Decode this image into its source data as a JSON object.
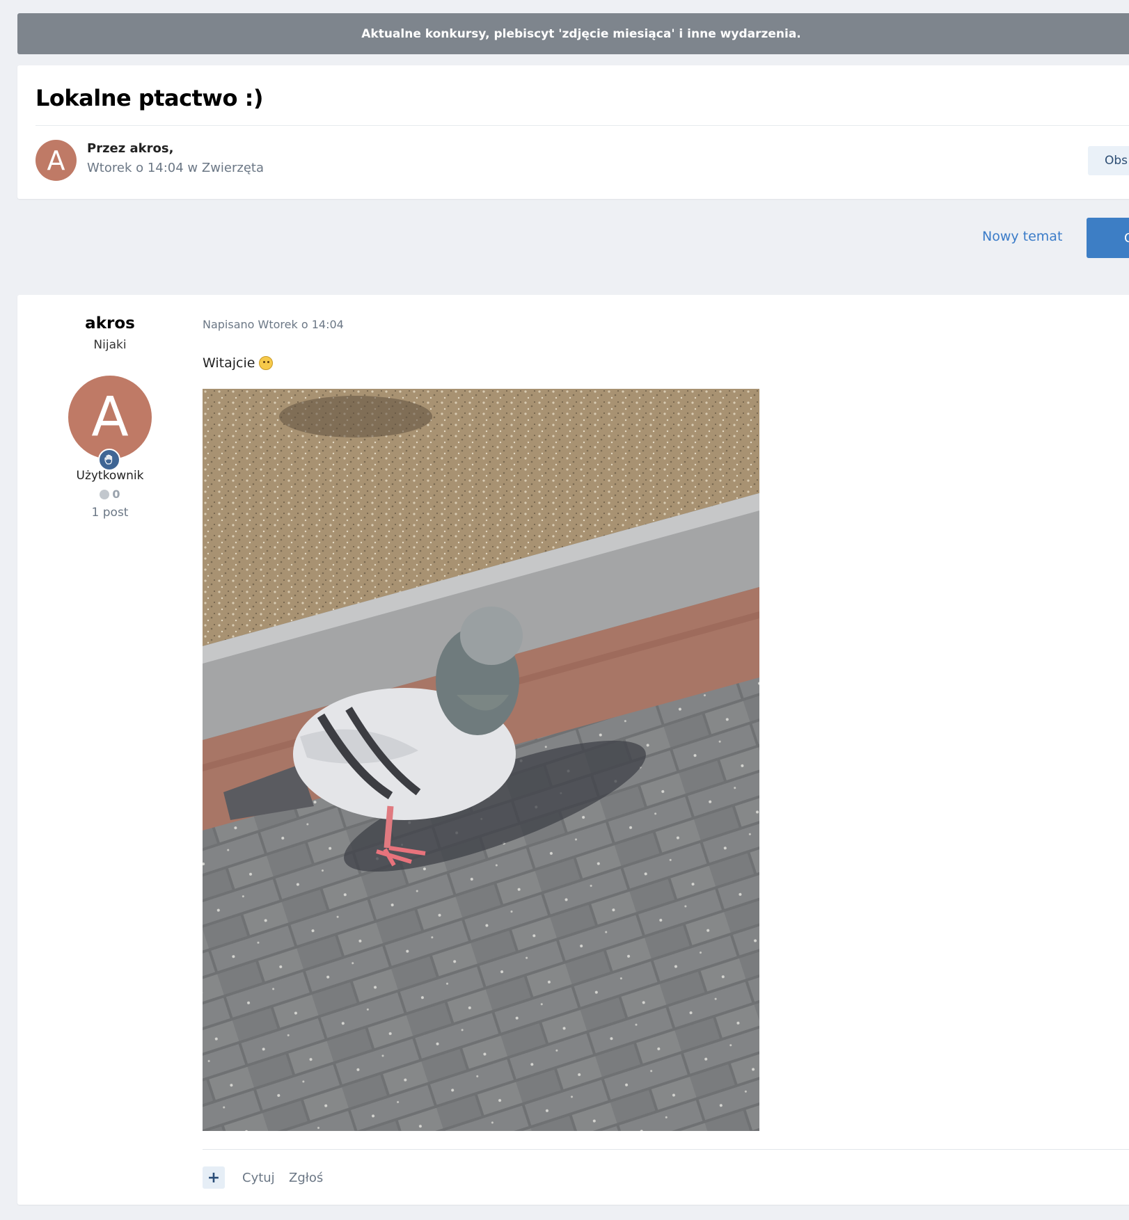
{
  "announcement": {
    "text": "Aktualne konkursy, plebiscyt 'zdjęcie miesiąca' i inne wydarzenia."
  },
  "topic": {
    "title": "Lokalne ptactwo :)",
    "avatar_letter": "A",
    "byline": "Przez akros,",
    "meta": "Wtorek o 14:04 w Zwierzęta",
    "follow_label": "Obs"
  },
  "actions": {
    "new_topic_label": "Nowy temat",
    "reply_label": "O"
  },
  "post": {
    "author": {
      "name": "akros",
      "title": "Nijaki",
      "avatar_letter": "A",
      "group": "Użytkownik",
      "reputation": "0",
      "post_count": "1 post"
    },
    "date": "Napisano Wtorek o 14:04",
    "text": "Witajcie",
    "image_subject": "pigeon on paving stones",
    "footer": {
      "plus_label": "+",
      "quote_label": "Cytuj",
      "report_label": "Zgłoś"
    }
  },
  "colors": {
    "background": "#eef0f4",
    "announcement_bg": "#7e858d",
    "avatar": "#bf7a66",
    "link": "#3a7bc8",
    "primary_button": "#3d7ec5",
    "muted_text": "#6b7785"
  }
}
